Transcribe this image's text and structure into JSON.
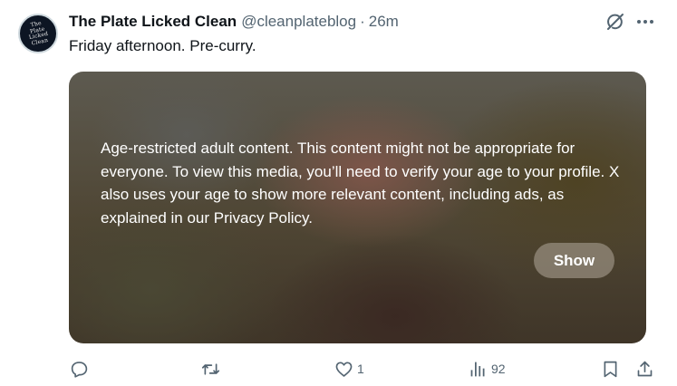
{
  "post": {
    "author": {
      "display_name": "The Plate Licked Clean",
      "handle": "@cleanplateblog",
      "avatar_text": "The Plate Licked Clean"
    },
    "separator": "·",
    "time": "26m",
    "text": "Friday afternoon. Pre-curry."
  },
  "media": {
    "warning": "Age-restricted adult content. This content might not be appropriate for everyone. To view this media, you’ll need to verify your age to your profile. X also uses your age to show more relevant content, including ads, as explained in our Privacy Policy.",
    "show_label": "Show"
  },
  "actions": {
    "reply_icon": "reply-icon",
    "repost_icon": "repost-icon",
    "like_icon": "heart-icon",
    "likes": "1",
    "views_icon": "views-icon",
    "views": "92",
    "bookmark_icon": "bookmark-icon",
    "share_icon": "share-icon"
  },
  "colors": {
    "text_primary": "#0f1419",
    "text_secondary": "#536471",
    "avatar_bg": "#0d1523"
  }
}
